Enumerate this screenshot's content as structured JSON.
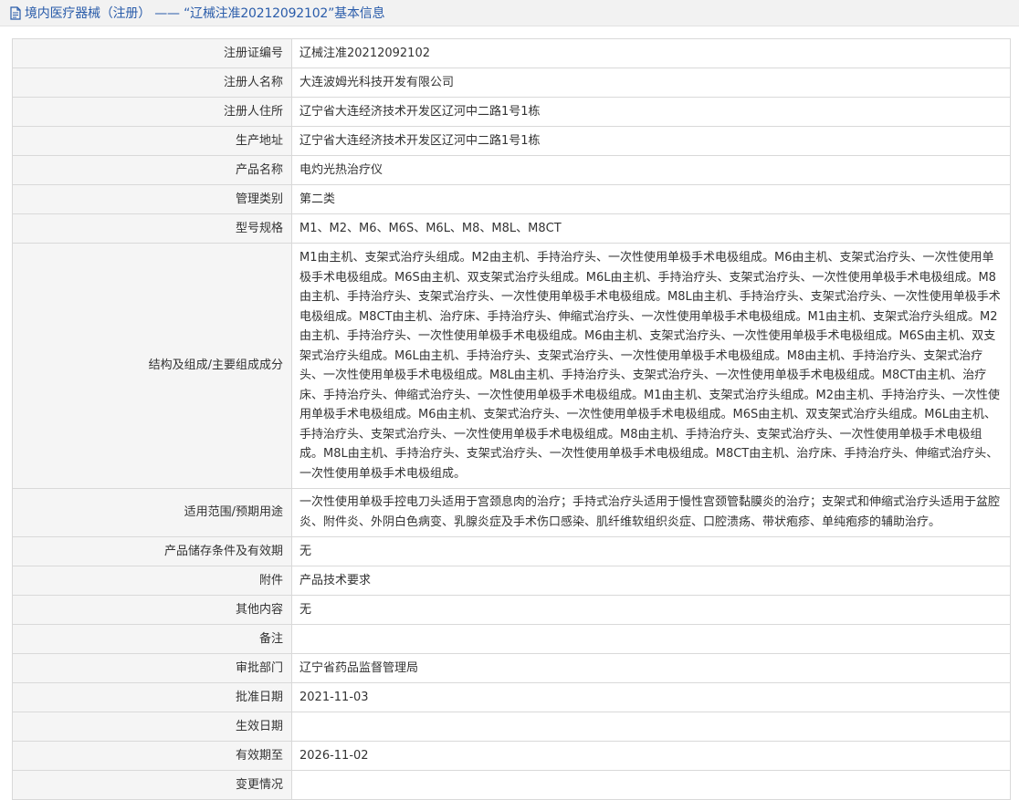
{
  "header": {
    "title": "境内医疗器械（注册） —— “辽械注准20212092102”基本信息",
    "icon": "document-icon"
  },
  "rows": [
    {
      "key": "reg_no",
      "label": "注册证编号",
      "value": "辽械注准20212092102"
    },
    {
      "key": "registrant",
      "label": "注册人名称",
      "value": "大连波姆光科技开发有限公司"
    },
    {
      "key": "registrant_address",
      "label": "注册人住所",
      "value": "辽宁省大连经济技术开发区辽河中二路1号1栋"
    },
    {
      "key": "production_address",
      "label": "生产地址",
      "value": "辽宁省大连经济技术开发区辽河中二路1号1栋"
    },
    {
      "key": "product_name",
      "label": "产品名称",
      "value": "电灼光热治疗仪"
    },
    {
      "key": "category",
      "label": "管理类别",
      "value": "第二类"
    },
    {
      "key": "models",
      "label": "型号规格",
      "value": "M1、M2、M6、M6S、M6L、M8、M8L、M8CT"
    },
    {
      "key": "structure",
      "label": "结构及组成/主要组成成分",
      "value": "M1由主机、支架式治疗头组成。M2由主机、手持治疗头、一次性使用单极手术电极组成。M6由主机、支架式治疗头、一次性使用单极手术电极组成。M6S由主机、双支架式治疗头组成。M6L由主机、手持治疗头、支架式治疗头、一次性使用单极手术电极组成。M8由主机、手持治疗头、支架式治疗头、一次性使用单极手术电极组成。M8L由主机、手持治疗头、支架式治疗头、一次性使用单极手术电极组成。M8CT由主机、治疗床、手持治疗头、伸缩式治疗头、一次性使用单极手术电极组成。M1由主机、支架式治疗头组成。M2由主机、手持治疗头、一次性使用单极手术电极组成。M6由主机、支架式治疗头、一次性使用单极手术电极组成。M6S由主机、双支架式治疗头组成。M6L由主机、手持治疗头、支架式治疗头、一次性使用单极手术电极组成。M8由主机、手持治疗头、支架式治疗头、一次性使用单极手术电极组成。M8L由主机、手持治疗头、支架式治疗头、一次性使用单极手术电极组成。M8CT由主机、治疗床、手持治疗头、伸缩式治疗头、一次性使用单极手术电极组成。M1由主机、支架式治疗头组成。M2由主机、手持治疗头、一次性使用单极手术电极组成。M6由主机、支架式治疗头、一次性使用单极手术电极组成。M6S由主机、双支架式治疗头组成。M6L由主机、手持治疗头、支架式治疗头、一次性使用单极手术电极组成。M8由主机、手持治疗头、支架式治疗头、一次性使用单极手术电极组成。M8L由主机、手持治疗头、支架式治疗头、一次性使用单极手术电极组成。M8CT由主机、治疗床、手持治疗头、伸缩式治疗头、一次性使用单极手术电极组成。"
    },
    {
      "key": "usage",
      "label": "适用范围/预期用途",
      "value": "一次性使用单极手控电刀头适用于宫颈息肉的治疗；手持式治疗头适用于慢性宫颈管黏膜炎的治疗；支架式和伸缩式治疗头适用于盆腔炎、附件炎、外阴白色病变、乳腺炎症及手术伤口感染、肌纤维软组织炎症、口腔溃疡、带状疱疹、单纯疱疹的辅助治疗。"
    },
    {
      "key": "storage",
      "label": "产品储存条件及有效期",
      "value": "无"
    },
    {
      "key": "attachment",
      "label": "附件",
      "value": "产品技术要求"
    },
    {
      "key": "other",
      "label": "其他内容",
      "value": "无"
    },
    {
      "key": "remark",
      "label": "备注",
      "value": ""
    },
    {
      "key": "approval_dept",
      "label": "审批部门",
      "value": "辽宁省药品监督管理局"
    },
    {
      "key": "approval_date",
      "label": "批准日期",
      "value": "2021-11-03"
    },
    {
      "key": "effective_date",
      "label": "生效日期",
      "value": ""
    },
    {
      "key": "valid_until",
      "label": "有效期至",
      "value": "2026-11-02"
    },
    {
      "key": "changes",
      "label": "变更情况",
      "value": ""
    }
  ],
  "colors": {
    "header_bg": "#f2f2f2",
    "header_text": "#2a5caa",
    "label_bg": "#f5f5f5",
    "border": "#d9d9d9",
    "text": "#333333"
  }
}
